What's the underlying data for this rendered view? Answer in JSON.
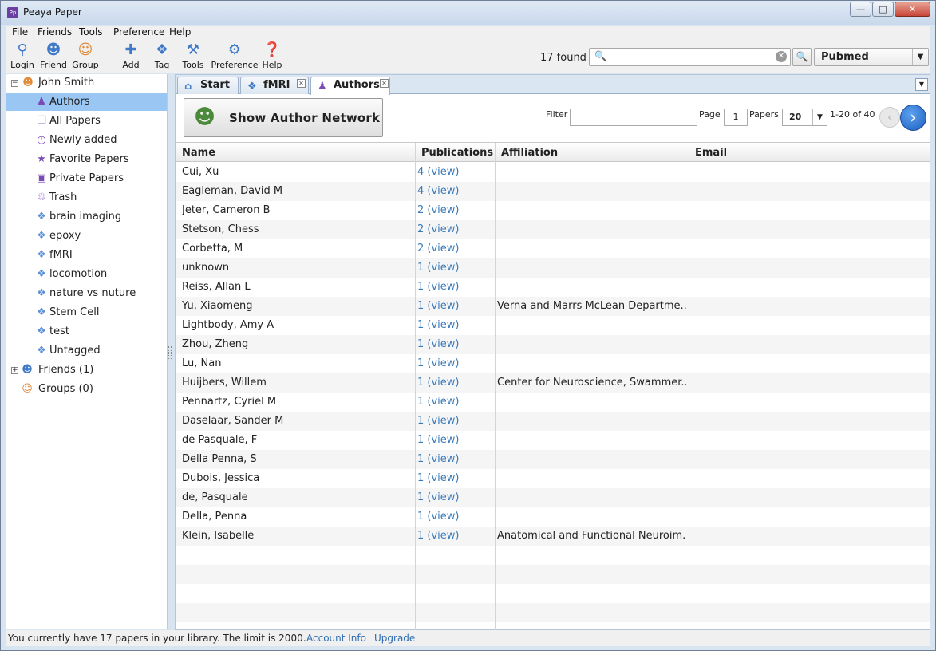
{
  "window": {
    "title": "Peaya Paper",
    "app_icon": "Pp"
  },
  "menu": [
    "File",
    "Friends",
    "Tools",
    "Preference",
    "Help"
  ],
  "toolbar": {
    "buttons": [
      {
        "label": "Login",
        "icon": "login-icon"
      },
      {
        "label": "Friend",
        "icon": "friend-icon"
      },
      {
        "label": "Group",
        "icon": "group-icon"
      },
      {
        "label": "Add",
        "icon": "add-icon"
      },
      {
        "label": "Tag",
        "icon": "tag-icon"
      },
      {
        "label": "Tools",
        "icon": "tools-icon"
      },
      {
        "label": "Preference",
        "icon": "gear-icon"
      },
      {
        "label": "Help",
        "icon": "help-icon"
      }
    ],
    "found": "17 found",
    "search_value": "",
    "source": "Pubmed"
  },
  "sidebar": {
    "user": "John Smith",
    "items": [
      {
        "label": "Authors",
        "icon": "author-icon",
        "selected": true
      },
      {
        "label": "All Papers",
        "icon": "papers-icon"
      },
      {
        "label": "Newly added",
        "icon": "clock-icon"
      },
      {
        "label": "Favorite Papers",
        "icon": "star-icon"
      },
      {
        "label": "Private Papers",
        "icon": "lock-icon"
      },
      {
        "label": "Trash",
        "icon": "trash-icon"
      },
      {
        "label": "brain imaging",
        "icon": "tag-icon"
      },
      {
        "label": "epoxy",
        "icon": "tag-icon"
      },
      {
        "label": "fMRI",
        "icon": "tag-icon"
      },
      {
        "label": "locomotion",
        "icon": "tag-icon"
      },
      {
        "label": "nature vs nuture",
        "icon": "tag-icon"
      },
      {
        "label": "Stem Cell",
        "icon": "tag-icon"
      },
      {
        "label": "test",
        "icon": "tag-icon"
      },
      {
        "label": "Untagged",
        "icon": "tag-icon"
      }
    ],
    "friends": "Friends (1)",
    "groups": "Groups (0)"
  },
  "tabs": [
    {
      "label": "Start",
      "icon": "home-icon",
      "closable": false,
      "active": false
    },
    {
      "label": "fMRI",
      "icon": "tag-icon",
      "closable": true,
      "active": false
    },
    {
      "label": "Authors",
      "icon": "author-icon",
      "closable": true,
      "active": true
    }
  ],
  "authors_view": {
    "network_button": "Show Author Network",
    "filter_label": "Filter",
    "filter_value": "",
    "page_label": "Page",
    "page_value": "1",
    "papers_label": "Papers",
    "per_page": "20",
    "range": "1-20 of 40"
  },
  "grid": {
    "columns": [
      "Name",
      "Publications",
      "Affiliation",
      "Email"
    ],
    "rows": [
      {
        "name": "Cui, Xu",
        "pubs": "4 (view)",
        "aff": "",
        "email": ""
      },
      {
        "name": "Eagleman, David M",
        "pubs": "4 (view)",
        "aff": "",
        "email": ""
      },
      {
        "name": "Jeter, Cameron B",
        "pubs": "2 (view)",
        "aff": "",
        "email": ""
      },
      {
        "name": "Stetson, Chess",
        "pubs": "2 (view)",
        "aff": "",
        "email": ""
      },
      {
        "name": "Corbetta, M",
        "pubs": "2 (view)",
        "aff": "",
        "email": ""
      },
      {
        "name": "unknown",
        "pubs": "1 (view)",
        "aff": "",
        "email": ""
      },
      {
        "name": "Reiss, Allan L",
        "pubs": "1 (view)",
        "aff": "",
        "email": ""
      },
      {
        "name": "Yu, Xiaomeng",
        "pubs": "1 (view)",
        "aff": "Verna and Marrs McLean Departme...",
        "email": ""
      },
      {
        "name": "Lightbody, Amy A",
        "pubs": "1 (view)",
        "aff": "",
        "email": ""
      },
      {
        "name": "Zhou, Zheng",
        "pubs": "1 (view)",
        "aff": "",
        "email": ""
      },
      {
        "name": "Lu, Nan",
        "pubs": "1 (view)",
        "aff": "",
        "email": ""
      },
      {
        "name": "Huijbers, Willem",
        "pubs": "1 (view)",
        "aff": "Center for Neuroscience, Swammer...",
        "email": ""
      },
      {
        "name": "Pennartz, Cyriel M",
        "pubs": "1 (view)",
        "aff": "",
        "email": ""
      },
      {
        "name": "Daselaar, Sander M",
        "pubs": "1 (view)",
        "aff": "",
        "email": ""
      },
      {
        "name": "de Pasquale, F",
        "pubs": "1 (view)",
        "aff": "",
        "email": ""
      },
      {
        "name": "Della Penna, S",
        "pubs": "1 (view)",
        "aff": "",
        "email": ""
      },
      {
        "name": "Dubois, Jessica",
        "pubs": "1 (view)",
        "aff": "",
        "email": ""
      },
      {
        "name": "de, Pasquale",
        "pubs": "1 (view)",
        "aff": "",
        "email": ""
      },
      {
        "name": "Della, Penna",
        "pubs": "1 (view)",
        "aff": "",
        "email": ""
      },
      {
        "name": "Klein, Isabelle",
        "pubs": "1 (view)",
        "aff": "Anatomical and Functional Neuroim...",
        "email": ""
      }
    ]
  },
  "status": {
    "text": "You currently have 17 papers in your library. The limit is 2000.",
    "account_link": "Account Info",
    "upgrade_link": "Upgrade"
  }
}
